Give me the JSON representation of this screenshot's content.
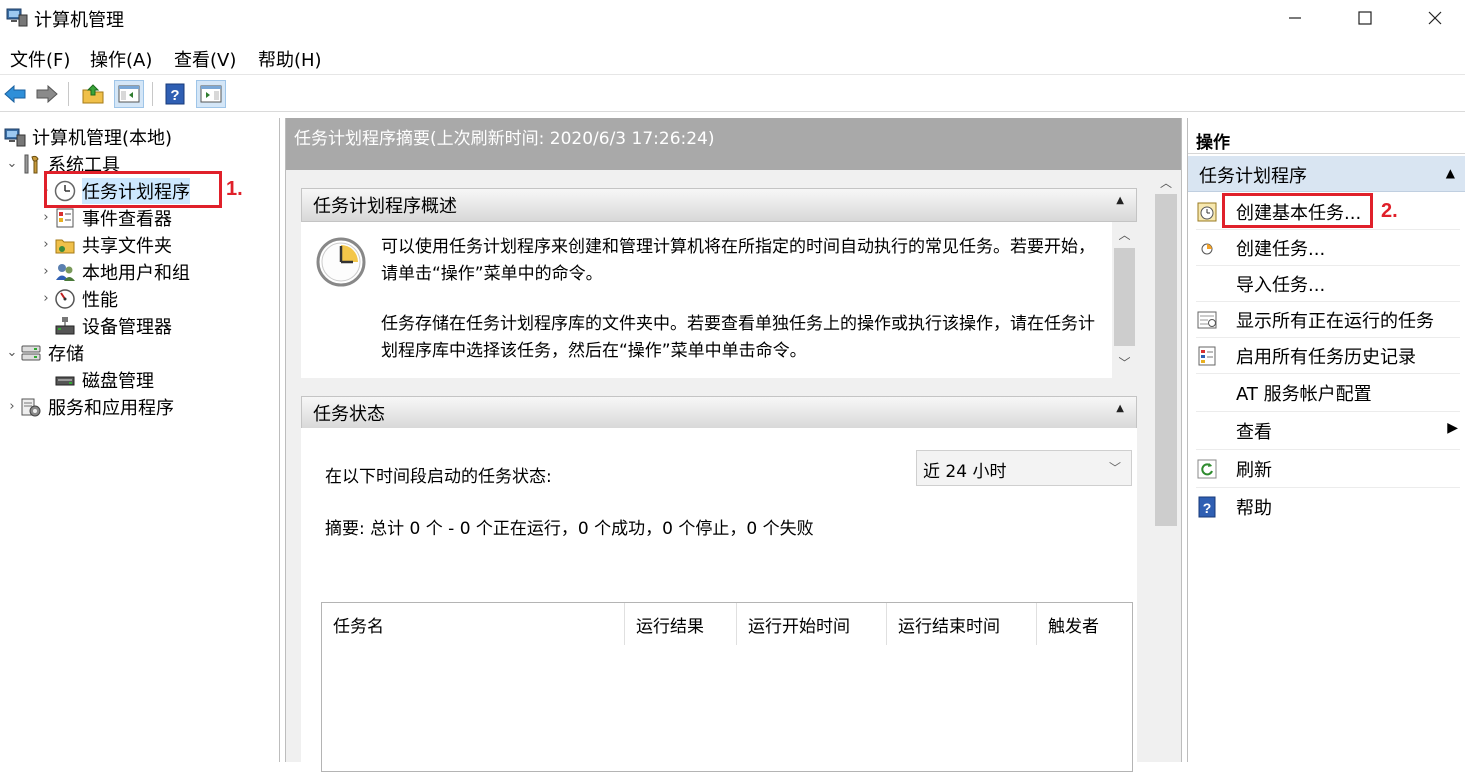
{
  "window": {
    "title": "计算机管理",
    "controls": {
      "minimize": "—",
      "maximize": "☐",
      "close": "✕"
    }
  },
  "menu": [
    "文件(F)",
    "操作(A)",
    "查看(V)",
    "帮助(H)"
  ],
  "tree": {
    "root": "计算机管理(本地)",
    "system_tools": "系统工具",
    "task_scheduler": "任务计划程序",
    "event_viewer": "事件查看器",
    "shared_folders": "共享文件夹",
    "local_users": "本地用户和组",
    "performance": "性能",
    "device_manager": "设备管理器",
    "storage": "存储",
    "disk_management": "磁盘管理",
    "services_apps": "服务和应用程序"
  },
  "annotations": {
    "step1": "1.",
    "step2": "2."
  },
  "middle": {
    "header": "任务计划程序摘要(上次刷新时间: 2020/6/3 17:26:24)",
    "overview_title": "任务计划程序概述",
    "overview_para1": "可以使用任务计划程序来创建和管理计算机将在所指定的时间自动执行的常见任务。若要开始，请单击“操作”菜单中的命令。",
    "overview_para2": "任务存储在任务计划程序库的文件夹中。若要查看单独任务上的操作或执行该操作，请在任务计划程序库中选择该任务，然后在“操作”菜单中单击命令。",
    "status_title": "任务状态",
    "status_label": "在以下时间段启动的任务状态:",
    "period_value": "近 24 小时",
    "summary": "摘要: 总计 0 个 - 0 个正在运行，0 个成功，0 个停止，0 个失败",
    "columns": [
      "任务名",
      "运行结果",
      "运行开始时间",
      "运行结束时间",
      "触发者"
    ]
  },
  "actions": {
    "title": "操作",
    "group": "任务计划程序",
    "items": [
      "创建基本任务...",
      "创建任务...",
      "导入任务...",
      "显示所有正在运行的任务",
      "启用所有任务历史记录",
      "AT 服务帐户配置",
      "查看",
      "刷新",
      "帮助"
    ]
  },
  "colors": {
    "highlight": "#e0202a",
    "selection": "#cde8ff",
    "header_gray": "#a9a9a9",
    "group_blue": "#d9e5f2"
  }
}
